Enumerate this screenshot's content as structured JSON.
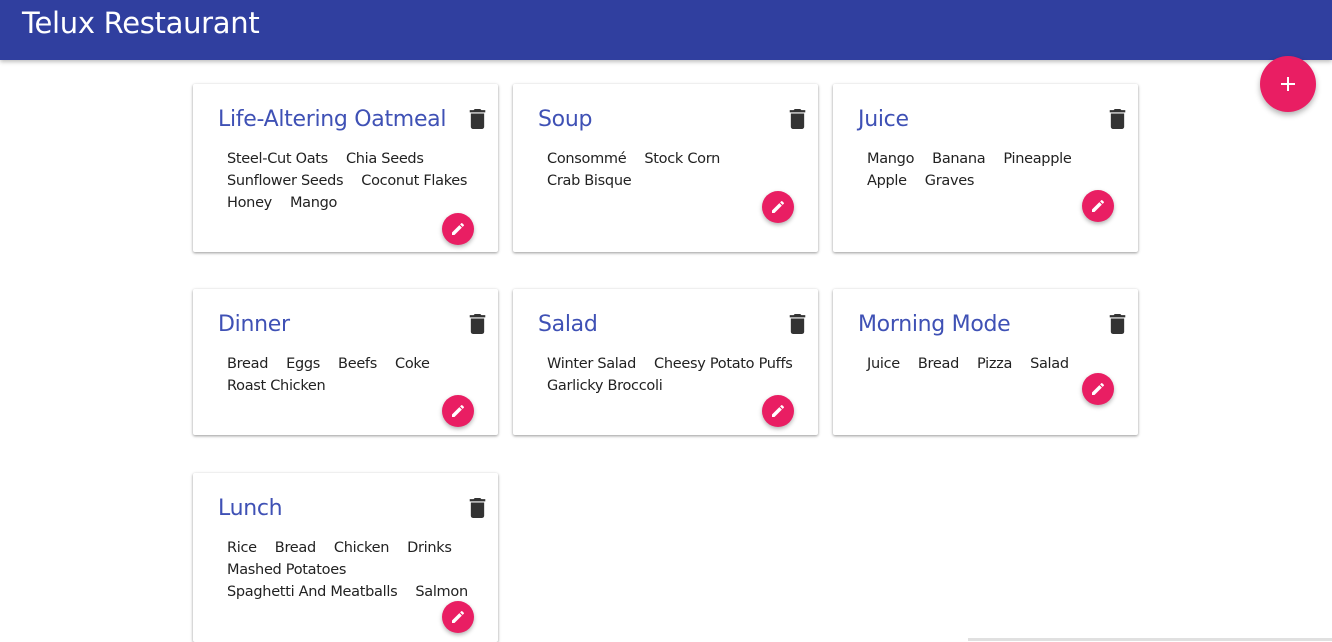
{
  "app": {
    "title": "Telux Restaurant"
  },
  "icons": {
    "add": "plus-icon",
    "delete": "trash-icon",
    "edit": "pencil-icon"
  },
  "colors": {
    "appbar": "#303f9f",
    "accent": "#e91e63",
    "card_title": "#3f51b5"
  },
  "cards": [
    {
      "title": "Life-Altering Oatmeal",
      "lines": [
        [
          "Steel-Cut Oats",
          "Chia Seeds"
        ],
        [
          "Sunflower Seeds",
          "Coconut Flakes"
        ],
        [
          "Honey",
          "Mango"
        ]
      ]
    },
    {
      "title": "Soup",
      "lines": [
        [
          "Consommé",
          "Stock Corn"
        ],
        [
          "Crab Bisque"
        ]
      ]
    },
    {
      "title": "Juice",
      "lines": [
        [
          "Mango",
          "Banana",
          "Pineapple"
        ],
        [
          "Apple",
          "Graves"
        ]
      ]
    },
    {
      "title": "Dinner",
      "lines": [
        [
          "Bread",
          "Eggs",
          "Beefs",
          "Coke"
        ],
        [
          "Roast Chicken"
        ]
      ]
    },
    {
      "title": "Salad",
      "lines": [
        [
          "Winter Salad",
          "Cheesy Potato Puffs"
        ],
        [
          "Garlicky Broccoli"
        ]
      ]
    },
    {
      "title": "Morning Mode",
      "lines": [
        [
          "Juice",
          "Bread",
          "Pizza",
          "Salad"
        ]
      ]
    },
    {
      "title": "Lunch",
      "lines": [
        [
          "Rice",
          "Bread",
          "Chicken",
          "Drinks"
        ],
        [
          "Mashed Potatoes"
        ],
        [
          "Spaghetti And Meatballs",
          "Salmon"
        ]
      ]
    }
  ]
}
